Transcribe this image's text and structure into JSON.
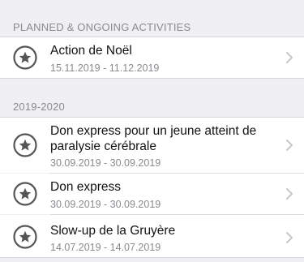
{
  "sections": [
    {
      "header": "PLANNED & ONGOING ACTIVITIES",
      "items": [
        {
          "title": "Action de Noël",
          "dates": "15.11.2019 - 11.12.2019",
          "icon": "star-circle-icon"
        }
      ]
    },
    {
      "header": "2019-2020",
      "items": [
        {
          "title": "Don express pour un jeune atteint de paralysie cérébrale",
          "dates": "30.09.2019 - 30.09.2019",
          "icon": "star-circle-icon"
        },
        {
          "title": "Don express",
          "dates": "30.09.2019 - 30.09.2019",
          "icon": "star-circle-icon"
        },
        {
          "title": "Slow-up de la Gruyère",
          "dates": "14.07.2019 - 14.07.2019",
          "icon": "star-circle-icon"
        }
      ]
    }
  ],
  "colors": {
    "background": "#efeff4",
    "row_background": "#ffffff",
    "header_text": "#8a8a8f",
    "title_text": "#111111",
    "icon": "#555555",
    "chevron": "#c7c7cc"
  }
}
